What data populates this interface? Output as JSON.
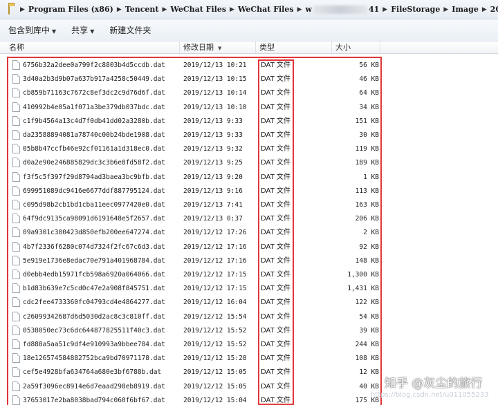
{
  "address_bar": {
    "crumbs": [
      "Program Files (x86)",
      "Tencent",
      "WeChat Files",
      "WeChat Files",
      "w",
      "41",
      "FileStorage",
      "Image",
      "2019-12"
    ]
  },
  "toolbar": {
    "include_library": "包含到库中",
    "share": "共享",
    "new_folder": "新建文件夹"
  },
  "columns": {
    "name": "名称",
    "date": "修改日期",
    "type": "类型",
    "size": "大小"
  },
  "files": [
    {
      "name": "6756b32a2dee0a799f2c8803b4d5ccdb.dat",
      "date": "2019/12/13 10:21",
      "type": "DAT 文件",
      "size": "56 KB"
    },
    {
      "name": "3d40a2b3d9b07a637b917a4258c50449.dat",
      "date": "2019/12/13 10:15",
      "type": "DAT 文件",
      "size": "46 KB"
    },
    {
      "name": "cb859b71163c7672c8ef3dc2c9d76d6f.dat",
      "date": "2019/12/13 10:14",
      "type": "DAT 文件",
      "size": "64 KB"
    },
    {
      "name": "410992b4e05a1f071a3be379db037bdc.dat",
      "date": "2019/12/13 10:10",
      "type": "DAT 文件",
      "size": "34 KB"
    },
    {
      "name": "c1f9b4564a13c4d7f0db41dd02a3280b.dat",
      "date": "2019/12/13 9:33",
      "type": "DAT 文件",
      "size": "151 KB"
    },
    {
      "name": "da23588894081a78740c00b24bde1908.dat",
      "date": "2019/12/13 9:33",
      "type": "DAT 文件",
      "size": "30 KB"
    },
    {
      "name": "05b8b47ccfb46e92cf01161a1d318ec0.dat",
      "date": "2019/12/13 9:32",
      "type": "DAT 文件",
      "size": "119 KB"
    },
    {
      "name": "d0a2e90e246885829dc3c3b6e8fd58f2.dat",
      "date": "2019/12/13 9:25",
      "type": "DAT 文件",
      "size": "189 KB"
    },
    {
      "name": "f3f5c5f397f29d8794ad3baea3bc9bfb.dat",
      "date": "2019/12/13 9:20",
      "type": "DAT 文件",
      "size": "1 KB"
    },
    {
      "name": "699951089dc9416e6677ddf887795124.dat",
      "date": "2019/12/13 9:16",
      "type": "DAT 文件",
      "size": "113 KB"
    },
    {
      "name": "c095d98b2cb1bd1cba11eec0977420e0.dat",
      "date": "2019/12/13 7:41",
      "type": "DAT 文件",
      "size": "163 KB"
    },
    {
      "name": "64f9dc9135ca98091d6191648e5f2657.dat",
      "date": "2019/12/13 0:37",
      "type": "DAT 文件",
      "size": "206 KB"
    },
    {
      "name": "09a9301c300423d850efb200ee647274.dat",
      "date": "2019/12/12 17:26",
      "type": "DAT 文件",
      "size": "2 KB"
    },
    {
      "name": "4b7f2336f6280c074d7324f2fc67c6d3.dat",
      "date": "2019/12/12 17:16",
      "type": "DAT 文件",
      "size": "92 KB"
    },
    {
      "name": "5e919e1736e8edac70e791a401968784.dat",
      "date": "2019/12/12 17:16",
      "type": "DAT 文件",
      "size": "148 KB"
    },
    {
      "name": "d0ebb4edb15971fcb598a6920a064066.dat",
      "date": "2019/12/12 17:15",
      "type": "DAT 文件",
      "size": "1,300 KB"
    },
    {
      "name": "b1d83b639e7c5cd0c47e2a908f845751.dat",
      "date": "2019/12/12 17:15",
      "type": "DAT 文件",
      "size": "1,431 KB"
    },
    {
      "name": "cdc2fee4733360fc04793cd4e4864277.dat",
      "date": "2019/12/12 16:04",
      "type": "DAT 文件",
      "size": "122 KB"
    },
    {
      "name": "c26099342687d6d5030d2ac8c3c810ff.dat",
      "date": "2019/12/12 15:54",
      "type": "DAT 文件",
      "size": "54 KB"
    },
    {
      "name": "0538050ec73c6dc644877825511f40c3.dat",
      "date": "2019/12/12 15:52",
      "type": "DAT 文件",
      "size": "39 KB"
    },
    {
      "name": "fd888a5aa51c9df4e910993a9bbee784.dat",
      "date": "2019/12/12 15:52",
      "type": "DAT 文件",
      "size": "244 KB"
    },
    {
      "name": "18e126574584882752bca9bd70971178.dat",
      "date": "2019/12/12 15:28",
      "type": "DAT 文件",
      "size": "108 KB"
    },
    {
      "name": "cef5e4928bfa634764a680e3bf6788b.dat",
      "date": "2019/12/12 15:05",
      "type": "DAT 文件",
      "size": "12 KB"
    },
    {
      "name": "2a59f3096ec8914e6d7eaad298eb8919.dat",
      "date": "2019/12/12 15:05",
      "type": "DAT 文件",
      "size": "40 KB"
    },
    {
      "name": "37653017e2ba8038bad794c060f6bf67.dat",
      "date": "2019/12/12 15:04",
      "type": "DAT 文件",
      "size": "175 KB"
    }
  ],
  "watermark": {
    "text": "知乎 @灰尘的旅行",
    "url": "https://blog.csdn.net/u011055233"
  },
  "colors": {
    "highlight": "#e0363a"
  }
}
